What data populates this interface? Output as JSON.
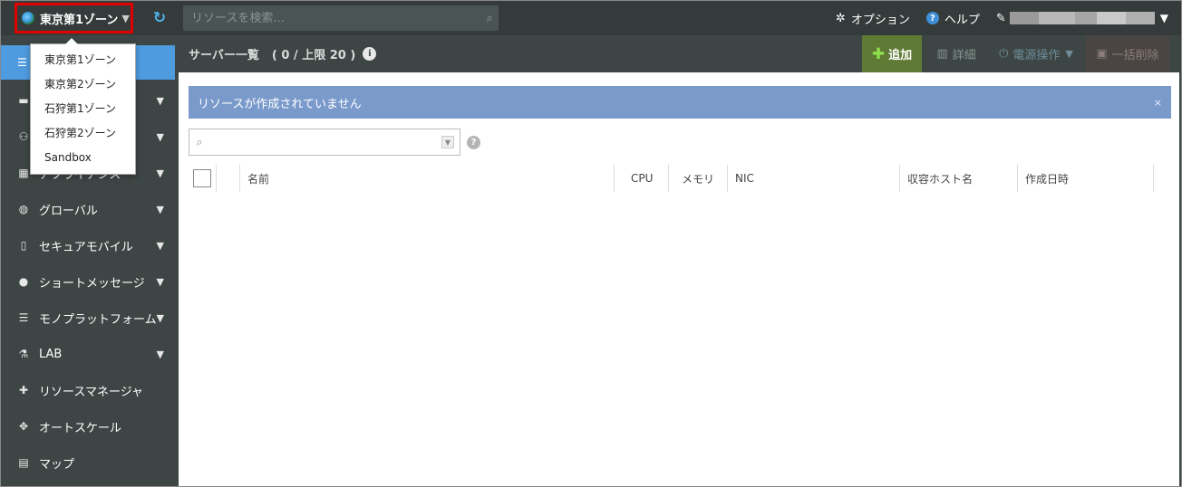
{
  "topbar": {
    "zone_label": "東京第1ゾーン",
    "search_placeholder": "リソースを検索...",
    "options_label": "オプション",
    "help_label": "ヘルプ"
  },
  "zone_dropdown": {
    "items": [
      "東京第1ゾーン",
      "東京第2ゾーン",
      "石狩第1ゾーン",
      "石狩第2ゾーン",
      "Sandbox"
    ]
  },
  "sidebar": {
    "items": [
      {
        "label": "グローバル",
        "icon": "globe-icon",
        "has_submenu": true
      },
      {
        "label": "セキュアモバイル",
        "icon": "mobile-icon",
        "has_submenu": true
      },
      {
        "label": "ショートメッセージ",
        "icon": "chat-bubble-icon",
        "has_submenu": true
      },
      {
        "label": "モノプラットフォーム",
        "icon": "stack-icon",
        "has_submenu": true
      },
      {
        "label": "LAB",
        "icon": "flask-icon",
        "has_submenu": true
      },
      {
        "label": "リソースマネージャ",
        "icon": "puzzle-icon",
        "has_submenu": false
      },
      {
        "label": "オートスケール",
        "icon": "move-arrows-icon",
        "has_submenu": false
      },
      {
        "label": "マップ",
        "icon": "map-icon",
        "has_submenu": false
      }
    ],
    "partially_hidden_label": "アプライアンス"
  },
  "header": {
    "title": "サーバー一覧",
    "count": "( 0 / 上限 20 )",
    "buttons": {
      "add": "追加",
      "detail": "詳細",
      "power": "電源操作",
      "bulk_delete": "一括削除"
    }
  },
  "alert": {
    "message": "リソースが作成されていません",
    "close": "×"
  },
  "table": {
    "columns": [
      "名前",
      "CPU",
      "メモリ",
      "NIC",
      "収容ホスト名",
      "作成日時"
    ],
    "rows": []
  },
  "colors": {
    "accent_blue": "#4f9be0",
    "alert_bg": "#7a9acb",
    "add_button_bg": "#5f7a34",
    "highlight_red": "#e00000"
  }
}
